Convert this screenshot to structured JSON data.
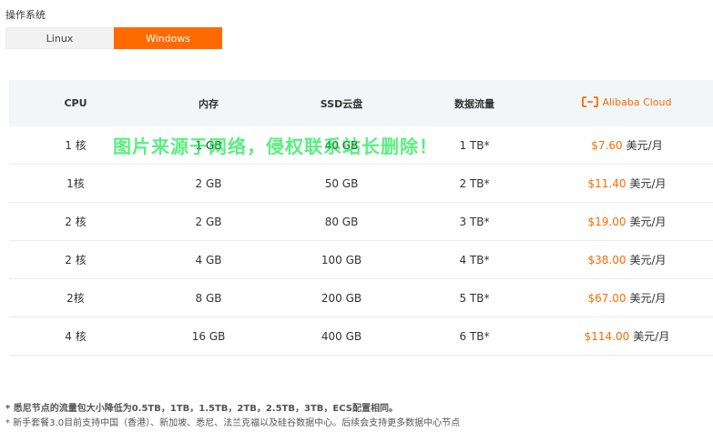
{
  "os": {
    "label": "操作系统",
    "options": [
      {
        "label": "Linux",
        "active": false
      },
      {
        "label": "Windows",
        "active": true
      }
    ],
    "active_color": "#ff6a00"
  },
  "table": {
    "headers": {
      "cpu": "CPU",
      "memory": "内存",
      "ssd": "SSD云盘",
      "traffic": "数据流量",
      "brand": "Alibaba Cloud"
    },
    "rows": [
      {
        "cpu": "1 核",
        "memory": "1 GB",
        "ssd": "40 GB",
        "traffic": "1 TB*",
        "price": "$7.60",
        "unit": "美元/月"
      },
      {
        "cpu": "1核",
        "memory": "2 GB",
        "ssd": "50 GB",
        "traffic": "2 TB*",
        "price": "$11.40",
        "unit": "美元/月"
      },
      {
        "cpu": "2 核",
        "memory": "2 GB",
        "ssd": "80 GB",
        "traffic": "3 TB*",
        "price": "$19.00",
        "unit": "美元/月"
      },
      {
        "cpu": "2 核",
        "memory": "4 GB",
        "ssd": "100 GB",
        "traffic": "4 TB*",
        "price": "$38.00",
        "unit": "美元/月"
      },
      {
        "cpu": "2核",
        "memory": "8 GB",
        "ssd": "200 GB",
        "traffic": "5 TB*",
        "price": "$67.00",
        "unit": "美元/月"
      },
      {
        "cpu": "4 核",
        "memory": "16 GB",
        "ssd": "400 GB",
        "traffic": "6 TB*",
        "price": "$114.00",
        "unit": "美元/月"
      }
    ]
  },
  "watermark": "图片来源于网络，侵权联系站长删除！",
  "notes": [
    "* 悉尼节点的流量包大小降低为0.5TB，1TB，1.5TB，2TB，2.5TB，3TB，ECS配置相同。",
    "* 新手套餐3.0目前支持中国（香港）、新加坡、悉尼、法兰克福以及硅谷数据中心。后续会支持更多数据中心节点"
  ]
}
